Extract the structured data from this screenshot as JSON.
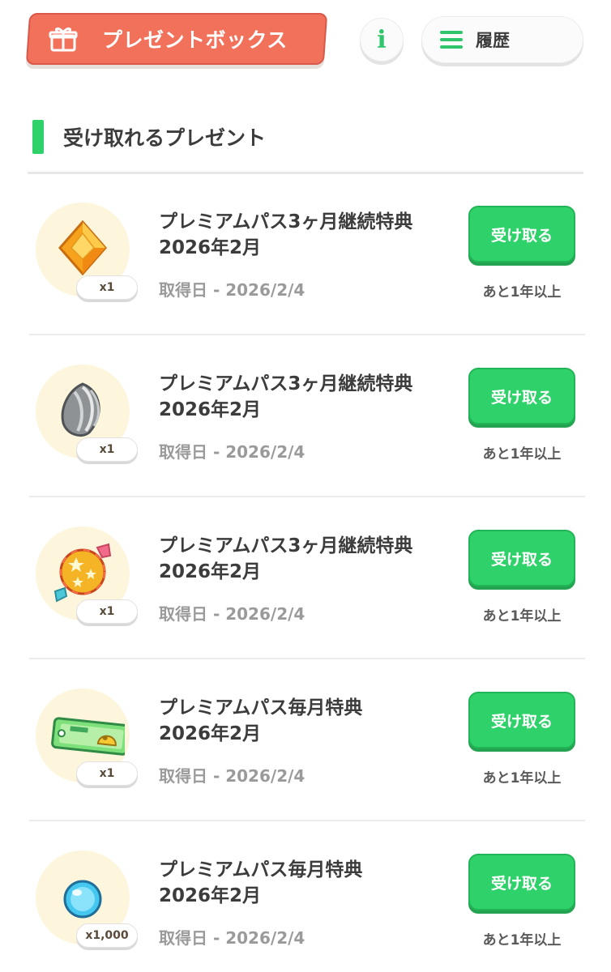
{
  "header": {
    "title": "プレゼントボックス",
    "info_label": "i",
    "history_label": "履歴"
  },
  "section": {
    "title": "受け取れるプレゼント"
  },
  "items": [
    {
      "icon": "orange-gem-icon",
      "quantity": "x1",
      "name_line1": "プレミアムパス3ヶ月継続特典",
      "name_line2": "2026年2月",
      "date": "取得日 - 2026/2/4",
      "button": "受け取る",
      "remaining": "あと1年以上"
    },
    {
      "icon": "seed-icon",
      "quantity": "x1",
      "name_line1": "プレミアムパス3ヶ月継続特典",
      "name_line2": "2026年2月",
      "date": "取得日 - 2026/2/4",
      "button": "受け取る",
      "remaining": "あと1年以上"
    },
    {
      "icon": "star-candy-icon",
      "quantity": "x1",
      "name_line1": "プレミアムパス3ヶ月継続特典",
      "name_line2": "2026年2月",
      "date": "取得日 - 2026/2/4",
      "button": "受け取る",
      "remaining": "あと1年以上"
    },
    {
      "icon": "ticket-icon",
      "quantity": "x1",
      "name_line1": "プレミアムパス毎月特典",
      "name_line2": "2026年2月",
      "date": "取得日 - 2026/2/4",
      "button": "受け取る",
      "remaining": "あと1年以上"
    },
    {
      "icon": "blue-orb-icon",
      "quantity": "x1,000",
      "name_line1": "プレミアムパス毎月特典",
      "name_line2": "2026年2月",
      "date": "取得日 - 2026/2/4",
      "button": "受け取る",
      "remaining": "あと1年以上"
    }
  ],
  "colors": {
    "accent_green": "#2fd26a",
    "title_tab": "#f2715a"
  }
}
